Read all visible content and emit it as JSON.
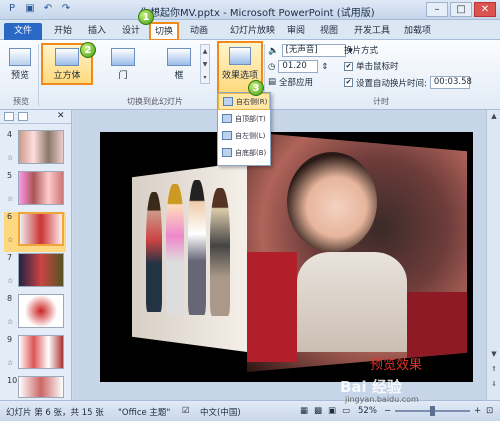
{
  "window": {
    "title": "你想起你MV.pptx - Microsoft PowerPoint (试用版)",
    "minimize": "–",
    "maximize": "□",
    "close": "✕"
  },
  "tabs": [
    "文件",
    "开始",
    "插入",
    "设计",
    "切换",
    "动画",
    "幻灯片放映",
    "审阅",
    "视图",
    "开发工具",
    "加载项"
  ],
  "active_tab": "切换",
  "badges": [
    "1",
    "2",
    "3"
  ],
  "ribbon": {
    "preview": {
      "label": "预览",
      "group": "预览"
    },
    "transitions": {
      "group": "切换到此幻灯片",
      "items": [
        "立方体",
        "门",
        "框"
      ],
      "selected": "立方体"
    },
    "effect_options": {
      "label": "效果选项"
    },
    "timing": {
      "sound": "[无声音]",
      "duration": "01.20",
      "apply_all": "全部应用",
      "advance_title": "换片方式",
      "on_click": "单击鼠标时",
      "on_click_checked": true,
      "auto_after": "设置自动换片时间:",
      "auto_after_checked": true,
      "auto_time": "00:03.58",
      "group": "计时"
    }
  },
  "effect_menu": {
    "items": [
      "自右侧(R)",
      "自顶部(T)",
      "自左侧(L)",
      "自底部(B)"
    ],
    "selected": "自右侧(R)"
  },
  "slides_panel": {
    "slides": [
      {
        "num": "4",
        "anim": "☆"
      },
      {
        "num": "5",
        "anim": "☆"
      },
      {
        "num": "6",
        "anim": "☆",
        "selected": true
      },
      {
        "num": "7",
        "anim": "☆"
      },
      {
        "num": "8",
        "anim": "☆"
      },
      {
        "num": "9",
        "anim": "☆"
      },
      {
        "num": "10",
        "anim": "☆"
      }
    ]
  },
  "slide": {
    "caption": "预览效果"
  },
  "status": {
    "slide_info": "幻灯片 第 6 张，共 15 张",
    "theme": "\"Office 主题\"",
    "language": "中文(中国)",
    "zoom": "52%"
  },
  "watermark": {
    "brand": "Bai 经验",
    "url": "jingyan.baidu.com"
  }
}
